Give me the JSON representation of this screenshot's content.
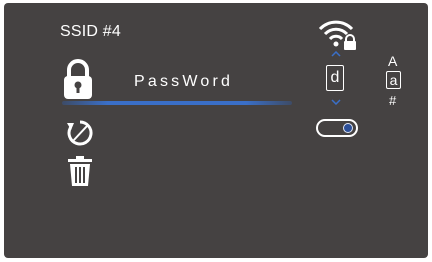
{
  "header": {
    "ssid": "SSID #4"
  },
  "password": {
    "value": "PassWord"
  },
  "char_picker": {
    "current": "d"
  },
  "charset": {
    "upper": "A",
    "lower": "a",
    "symbol": "#"
  },
  "toggle": {
    "state": "on"
  },
  "icons": {
    "lock": "lock-icon",
    "reset": "reset-icon",
    "trash": "trash-icon",
    "wifi": "wifi-lock-icon",
    "up": "chevron-up-icon",
    "down": "chevron-down-icon"
  },
  "colors": {
    "background": "#454242",
    "accent": "#3a6fc8",
    "text": "#ffffff"
  }
}
